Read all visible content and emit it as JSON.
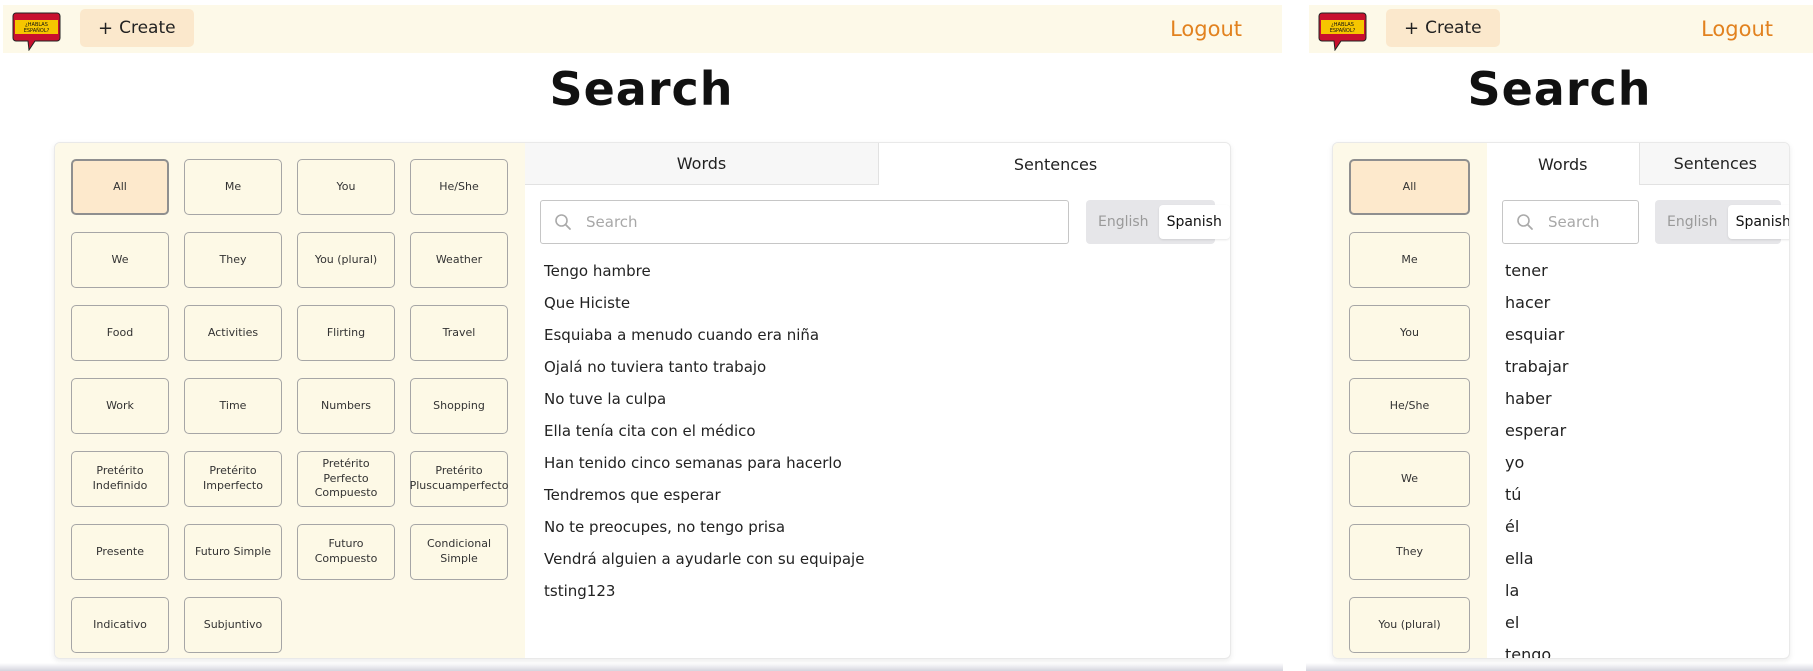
{
  "desktop": {
    "logo_text": "¿HABLAS ESPAÑOL?",
    "create_label": "Create",
    "logout_label": "Logout",
    "page_title": "Search",
    "categories": [
      "All",
      "Me",
      "You",
      "He/She",
      "We",
      "They",
      "You (plural)",
      "Weather",
      "Food",
      "Activities",
      "Flirting",
      "Travel",
      "Work",
      "Time",
      "Numbers",
      "Shopping",
      "Pretérito Indefinido",
      "Pretérito Imperfecto",
      "Pretérito Perfecto Compuesto",
      "Pretérito Pluscuamperfecto",
      "Presente",
      "Futuro Simple",
      "Futuro Compuesto",
      "Condicional Simple",
      "Indicativo",
      "Subjuntivo"
    ],
    "active_category": "All",
    "tabs": {
      "words": "Words",
      "sentences": "Sentences"
    },
    "selected_tab": "Sentences",
    "search_placeholder": "Search",
    "search_value": "",
    "lang": {
      "english": "English",
      "spanish": "Spanish"
    },
    "selected_lang": "Spanish",
    "results": [
      "Tengo hambre",
      "Que Hiciste",
      "Esquiaba a menudo cuando era niña",
      "Ojalá no tuviera tanto trabajo",
      "No tuve la culpa",
      "Ella tenía cita con el médico",
      "Han tenido cinco semanas para hacerlo",
      "Tendremos que esperar",
      "No te preocupes, no tengo prisa",
      "Vendrá alguien a ayudarle con su equipaje",
      "tsting123"
    ]
  },
  "mobile": {
    "logo_text": "¿HABLAS ESPAÑOL?",
    "create_label": "Create",
    "logout_label": "Logout",
    "page_title": "Search",
    "categories": [
      "All",
      "Me",
      "You",
      "He/She",
      "We",
      "They",
      "You (plural)"
    ],
    "active_category": "All",
    "tabs": {
      "words": "Words",
      "sentences": "Sentences"
    },
    "selected_tab": "Words",
    "search_placeholder": "Search",
    "search_value": "",
    "lang": {
      "english": "English",
      "spanish": "Spanish"
    },
    "selected_lang": "Spanish",
    "results": [
      "tener",
      "hacer",
      "esquiar",
      "trabajar",
      "haber",
      "esperar",
      "yo",
      "tú",
      "él",
      "ella",
      "la",
      "el",
      "tengo"
    ]
  },
  "colors": {
    "topbar_bg": "#fdf9e8",
    "create_bg": "#fbe8cc",
    "logout": "#e2821f",
    "category_active_bg": "#fde9cc",
    "flag_red": "#c8102e",
    "flag_yellow": "#f6c600"
  }
}
